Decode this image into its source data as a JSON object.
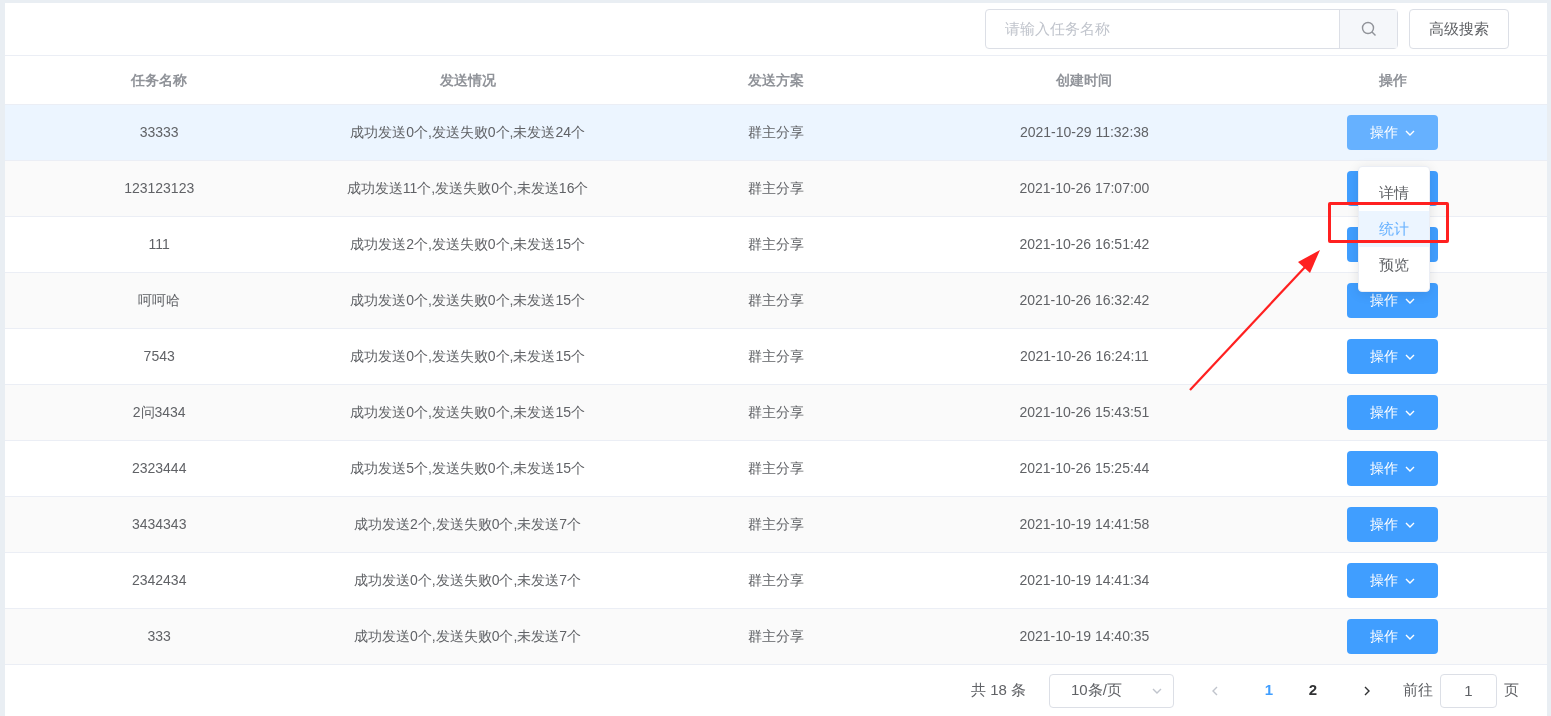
{
  "toolbar": {
    "search": {
      "placeholder": "请输入任务名称"
    },
    "advanced_button": "高级搜索"
  },
  "table": {
    "columns": [
      "任务名称",
      "发送情况",
      "发送方案",
      "创建时间",
      "操作"
    ],
    "rows": [
      {
        "name": "33333",
        "status": "成功发送0个,发送失败0个,未发送24个",
        "plan": "群主分享",
        "created": "2021-10-29 11:32:38",
        "action": "操作",
        "selected": true
      },
      {
        "name": "123123123",
        "status": "成功发送11个,发送失败0个,未发送16个",
        "plan": "群主分享",
        "created": "2021-10-26 17:07:00",
        "selected": false
      },
      {
        "name": "111",
        "status": "成功发送2个,发送失败0个,未发送15个",
        "plan": "群主分享",
        "created": "2021-10-26 16:51:42",
        "selected": false
      },
      {
        "name": "呵呵哈",
        "status": "成功发送0个,发送失败0个,未发送15个",
        "plan": "群主分享",
        "created": "2021-10-26 16:32:42",
        "action": "操作",
        "selected": false
      },
      {
        "name": "7543",
        "status": "成功发送0个,发送失败0个,未发送15个",
        "plan": "群主分享",
        "created": "2021-10-26 16:24:11",
        "action": "操作",
        "selected": false
      },
      {
        "name": "2问3434",
        "status": "成功发送0个,发送失败0个,未发送15个",
        "plan": "群主分享",
        "created": "2021-10-26 15:43:51",
        "action": "操作",
        "selected": false
      },
      {
        "name": "2323444",
        "status": "成功发送5个,发送失败0个,未发送15个",
        "plan": "群主分享",
        "created": "2021-10-26 15:25:44",
        "action": "操作",
        "selected": false
      },
      {
        "name": "3434343",
        "status": "成功发送2个,发送失败0个,未发送7个",
        "plan": "群主分享",
        "created": "2021-10-19 14:41:58",
        "action": "操作",
        "selected": false
      },
      {
        "name": "2342434",
        "status": "成功发送0个,发送失败0个,未发送7个",
        "plan": "群主分享",
        "created": "2021-10-19 14:41:34",
        "action": "操作",
        "selected": false
      },
      {
        "name": "333",
        "status": "成功发送0个,发送失败0个,未发送7个",
        "plan": "群主分享",
        "created": "2021-10-19 14:40:35",
        "action": "操作",
        "selected": false
      }
    ]
  },
  "dropdown_menu": {
    "items": [
      {
        "label": "详情",
        "selected": false
      },
      {
        "label": "统计",
        "selected": true
      },
      {
        "label": "预览",
        "selected": false
      }
    ]
  },
  "pagination": {
    "total": "共 18 条",
    "page_size": "10条/页",
    "prev_disabled": true,
    "pages": [
      {
        "label": "1",
        "selected": true
      },
      {
        "label": "2",
        "selected": false
      }
    ],
    "next_disabled": false,
    "goto_label": "前往",
    "goto_value": "1",
    "goto_suffix": "页"
  }
}
